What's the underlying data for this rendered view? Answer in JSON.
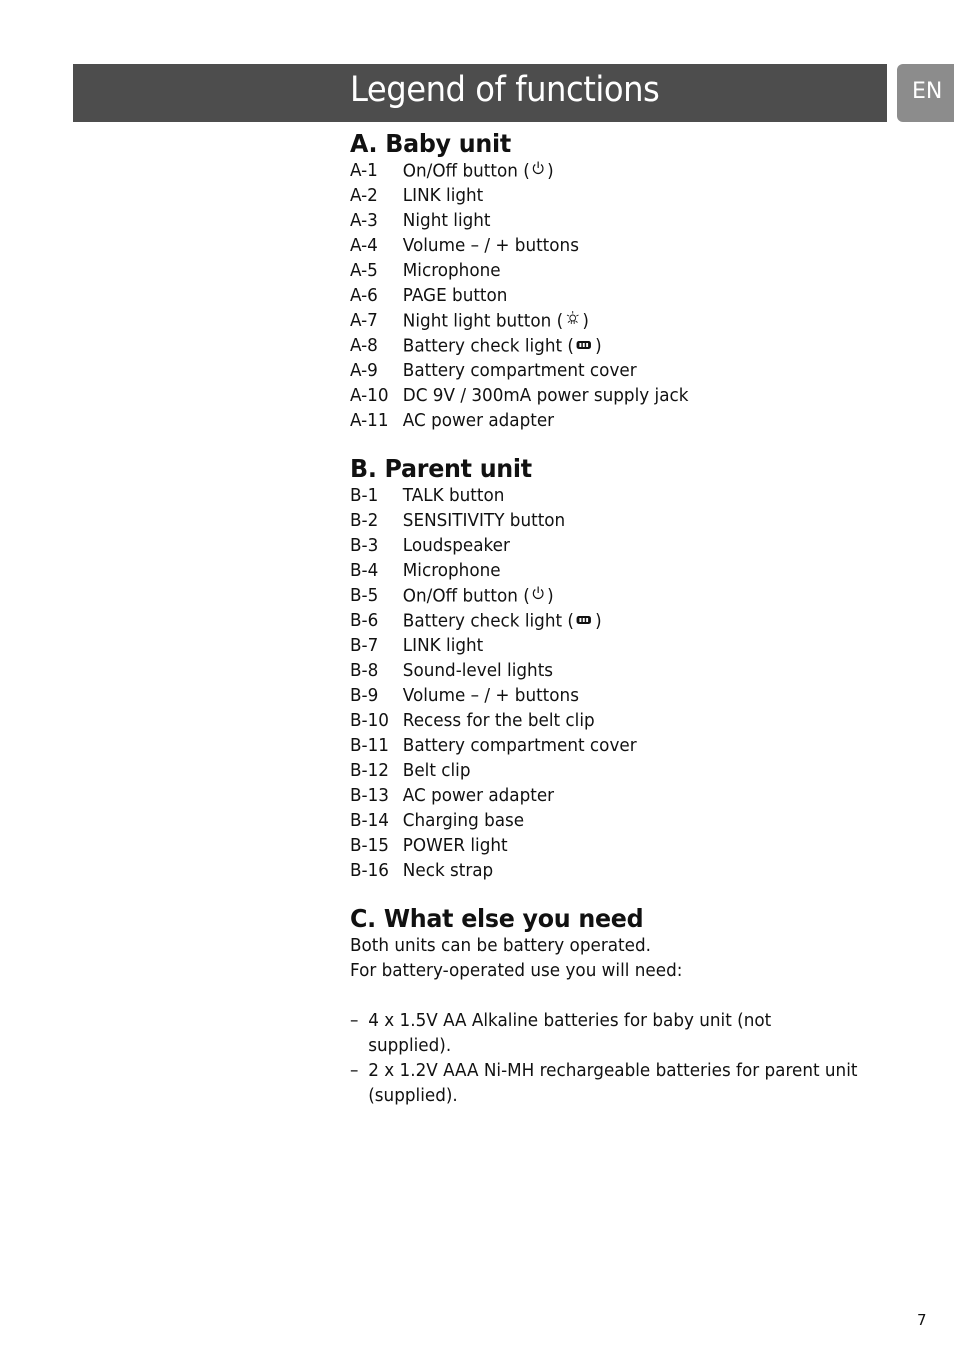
{
  "header": {
    "title": "Legend of functions",
    "language_tab": "EN"
  },
  "sections": {
    "baby_unit": {
      "heading": "A. Baby unit",
      "items": [
        {
          "code": "A-1",
          "label": "On/Off button (",
          "icon": "power-icon",
          "suffix": ")"
        },
        {
          "code": "A-2",
          "label": "LINK light"
        },
        {
          "code": "A-3",
          "label": "Night light"
        },
        {
          "code": "A-4",
          "label": "Volume – / + buttons"
        },
        {
          "code": "A-5",
          "label": "Microphone"
        },
        {
          "code": "A-6",
          "label": "PAGE button"
        },
        {
          "code": "A-7",
          "label": "Night light button (",
          "icon": "light-bulb-icon",
          "suffix": ")"
        },
        {
          "code": "A-8",
          "label": "Battery check light (",
          "icon": "battery-icon",
          "suffix": ")"
        },
        {
          "code": "A-9",
          "label": "Battery compartment cover"
        },
        {
          "code": "A-10",
          "label": "DC 9V / 300mA power supply jack"
        },
        {
          "code": "A-11",
          "label": "AC power adapter"
        }
      ]
    },
    "parent_unit": {
      "heading": "B. Parent unit",
      "items": [
        {
          "code": "B-1",
          "label": "TALK button"
        },
        {
          "code": "B-2",
          "label": "SENSITIVITY button"
        },
        {
          "code": "B-3",
          "label": "Loudspeaker"
        },
        {
          "code": "B-4",
          "label": "Microphone"
        },
        {
          "code": "B-5",
          "label": "On/Off button (",
          "icon": "power-icon",
          "suffix": ")"
        },
        {
          "code": "B-6",
          "label": "Battery check light (",
          "icon": "battery-icon",
          "suffix": ")"
        },
        {
          "code": "B-7",
          "label": "LINK light"
        },
        {
          "code": "B-8",
          "label": "Sound-level lights"
        },
        {
          "code": "B-9",
          "label": "Volume – / + buttons"
        },
        {
          "code": "B-10",
          "label": "Recess for the belt clip"
        },
        {
          "code": "B-11",
          "label": "Battery compartment cover"
        },
        {
          "code": "B-12",
          "label": "Belt clip"
        },
        {
          "code": "B-13",
          "label": "AC power adapter"
        },
        {
          "code": "B-14",
          "label": "Charging base"
        },
        {
          "code": "B-15",
          "label": "POWER light"
        },
        {
          "code": "B-16",
          "label": "Neck strap"
        }
      ]
    },
    "what_else": {
      "heading": "C. What else you need",
      "paragraphs": [
        "Both units can be battery operated.",
        "For battery-operated use you will need:"
      ],
      "bullets": [
        "4 x 1.5V AA Alkaline batteries for baby unit (not supplied).",
        "2 x 1.2V AAA Ni-MH rechargeable batteries for parent unit (supplied)."
      ],
      "bullet_marker": "–"
    }
  },
  "footer": {
    "page_number": "7"
  }
}
